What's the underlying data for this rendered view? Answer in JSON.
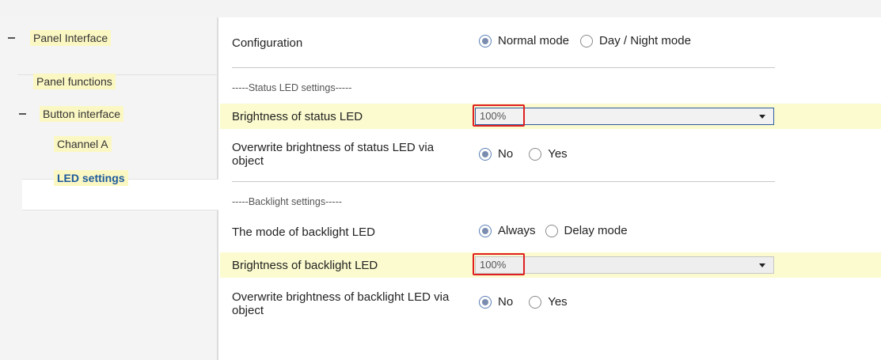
{
  "sidebar": {
    "items": [
      {
        "label": "Panel Interface",
        "expanded": true
      },
      {
        "label": "Panel functions"
      },
      {
        "label": "Button interface",
        "expanded": true
      },
      {
        "label": "Channel A"
      },
      {
        "label": "LED settings",
        "selected": true
      }
    ]
  },
  "main": {
    "configuration": {
      "label": "Configuration",
      "options": [
        "Normal mode",
        "Day / Night mode"
      ],
      "selected": "Normal mode"
    },
    "status_section_title": "-----Status LED settings-----",
    "brightness_status": {
      "label": "Brightness of status LED",
      "value": "100%"
    },
    "overwrite_status": {
      "label_line1": "Overwrite brightness of status LED via",
      "label_line2": "object",
      "options": [
        "No",
        "Yes"
      ],
      "selected": "No"
    },
    "backlight_section_title": "-----Backlight settings-----",
    "backlight_mode": {
      "label": "The mode of backlight LED",
      "options": [
        "Always",
        "Delay mode"
      ],
      "selected": "Always"
    },
    "brightness_backlight": {
      "label": "Brightness of backlight LED",
      "value": "100%"
    },
    "overwrite_backlight": {
      "label_line1": "Overwrite brightness of backlight LED via",
      "label_line2": "object",
      "options": [
        "No",
        "Yes"
      ],
      "selected": "No"
    }
  },
  "colors": {
    "highlight_row": "#fbfbcf",
    "label_highlight": "#fbf7c3",
    "selected_text": "#1c5a9c",
    "annotation_red": "#e02020"
  }
}
